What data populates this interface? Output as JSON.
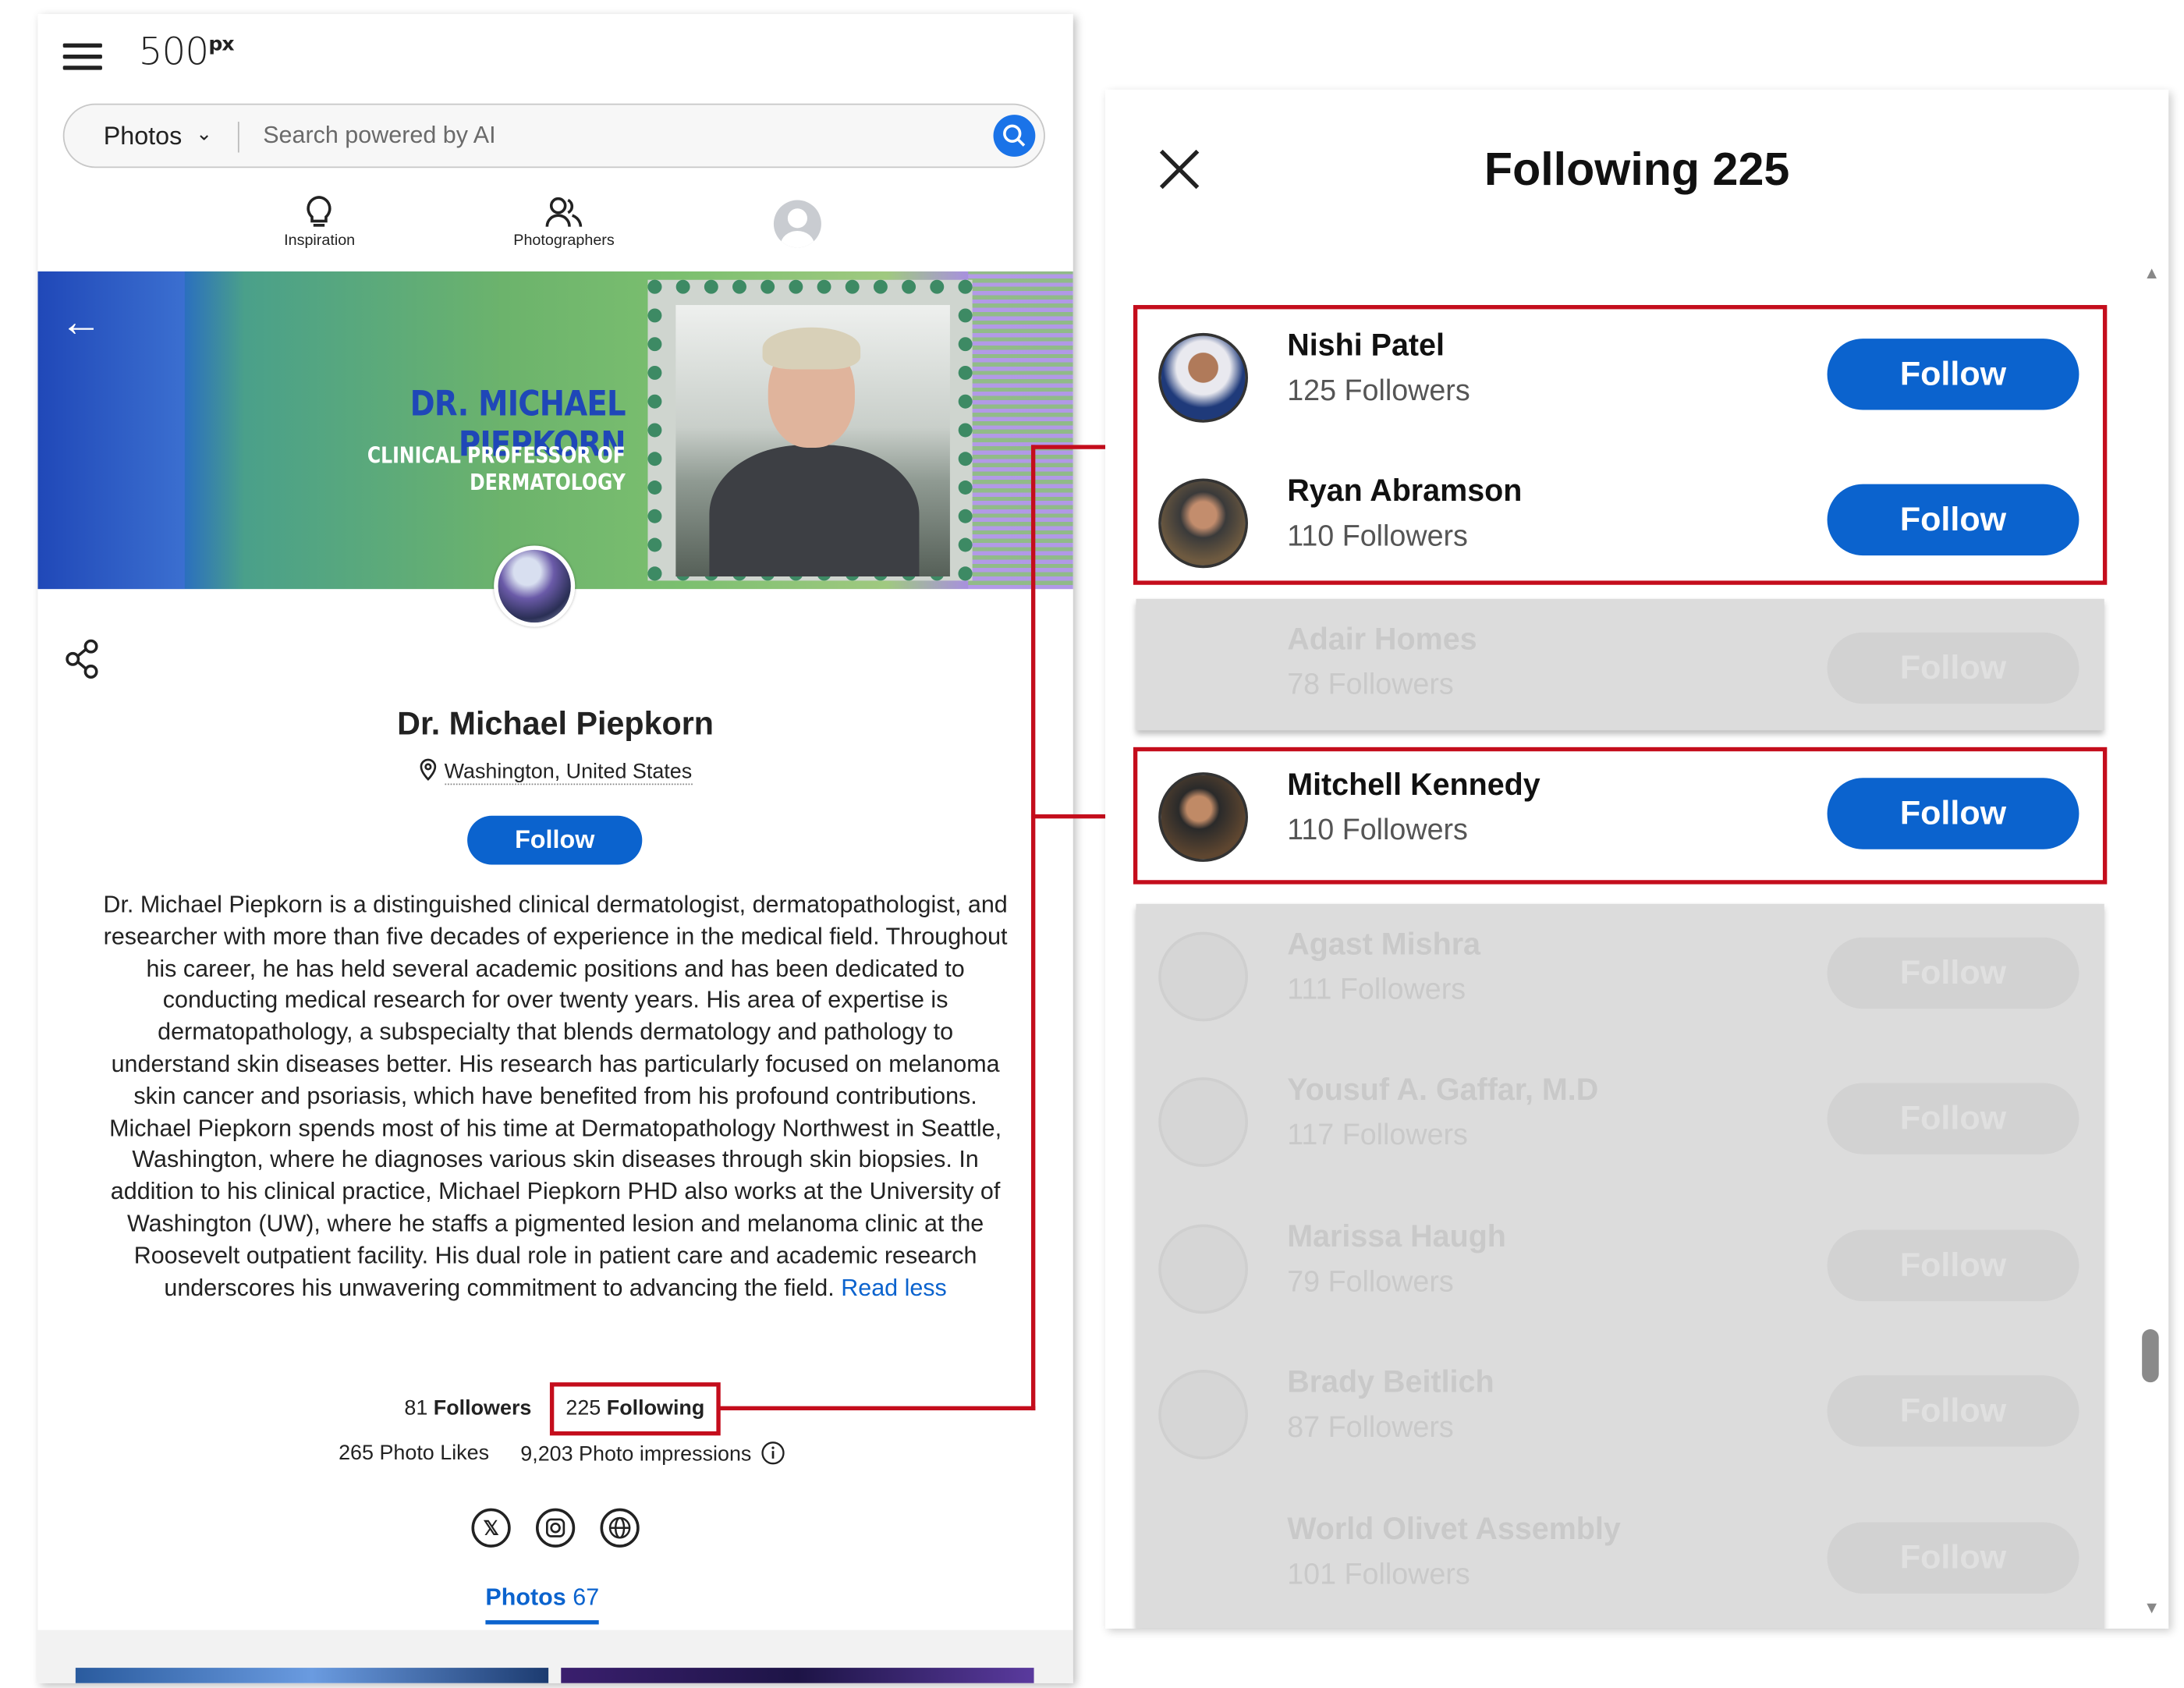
{
  "left": {
    "logo": "500px",
    "logo_main": "500",
    "logo_sup": "px",
    "search": {
      "category": "Photos",
      "placeholder": "Search powered by AI"
    },
    "nav": {
      "inspiration": "Inspiration",
      "photographers": "Photographers"
    },
    "banner": {
      "name": "DR. MICHAEL PIEPKORN",
      "title": "CLINICAL PROFESSOR OF DERMATOLOGY"
    },
    "profile": {
      "name": "Dr. Michael Piepkorn",
      "location": "Washington, United States",
      "follow_label": "Follow",
      "bio": "Dr. Michael Piepkorn is a distinguished clinical dermatologist, dermatopathologist, and researcher with more than five decades of experience in the medical field. Throughout his career, he has held several academic positions and has been dedicated to conducting medical research for over twenty years. His area of expertise is dermatopathology, a subspecialty that blends dermatology and pathology to understand skin diseases better. His research has particularly focused on melanoma skin cancer and psoriasis, which have benefited from his profound contributions. Michael Piepkorn spends most of his time at Dermatopathology Northwest in Seattle, Washington, where he diagnoses various skin diseases through skin biopsies. In addition to his clinical practice, Michael Piepkorn PHD also works at the University of Washington (UW), where he staffs a pigmented lesion and melanoma clinic at the Roosevelt outpatient facility. His dual role in patient care and academic research underscores his unwavering commitment to advancing the field.",
      "read_less": "Read less",
      "followers_count": "81",
      "followers_label": "Followers",
      "following_count": "225",
      "following_label": "Following",
      "photo_likes": "265 Photo Likes",
      "photo_impressions": "9,203 Photo impressions",
      "tab_photos": "Photos",
      "tab_photos_count": "67"
    }
  },
  "modal": {
    "title": "Following 225",
    "follow_label": "Follow",
    "users": [
      {
        "name": "Nishi Patel",
        "followers": "125 Followers",
        "highlighted": true
      },
      {
        "name": "Ryan Abramson",
        "followers": "110 Followers",
        "highlighted": true
      },
      {
        "name": "Adair Homes",
        "followers": "78 Followers",
        "highlighted": false
      },
      {
        "name": "Mitchell Kennedy",
        "followers": "110 Followers",
        "highlighted": true
      },
      {
        "name": "Agast Mishra",
        "followers": "111 Followers",
        "highlighted": false
      },
      {
        "name": "Yousuf A. Gaffar, M.D",
        "followers": "117 Followers",
        "highlighted": false
      },
      {
        "name": "Marissa Haugh",
        "followers": "79 Followers",
        "highlighted": false
      },
      {
        "name": "Brady Beitlich",
        "followers": "87 Followers",
        "highlighted": false
      },
      {
        "name": "World Olivet Assembly",
        "followers": "101 Followers",
        "highlighted": false
      }
    ]
  },
  "colors": {
    "accent": "#0b63ce",
    "highlight": "#c40d1c"
  }
}
